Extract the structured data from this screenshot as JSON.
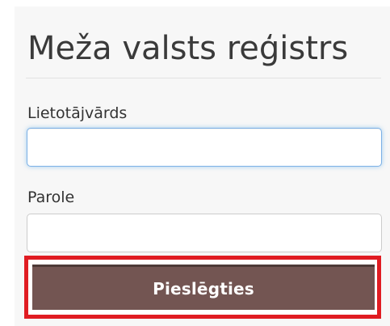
{
  "header": {
    "title": "Meža valsts reģistrs"
  },
  "login_form": {
    "username_label": "Lietotājvārds",
    "username_value": "",
    "password_label": "Parole",
    "password_value": "",
    "submit_label": "Pieslēgties"
  },
  "colors": {
    "button_bg": "#735552",
    "highlight_border": "#e01c22",
    "focus_border": "#7db1e6"
  }
}
